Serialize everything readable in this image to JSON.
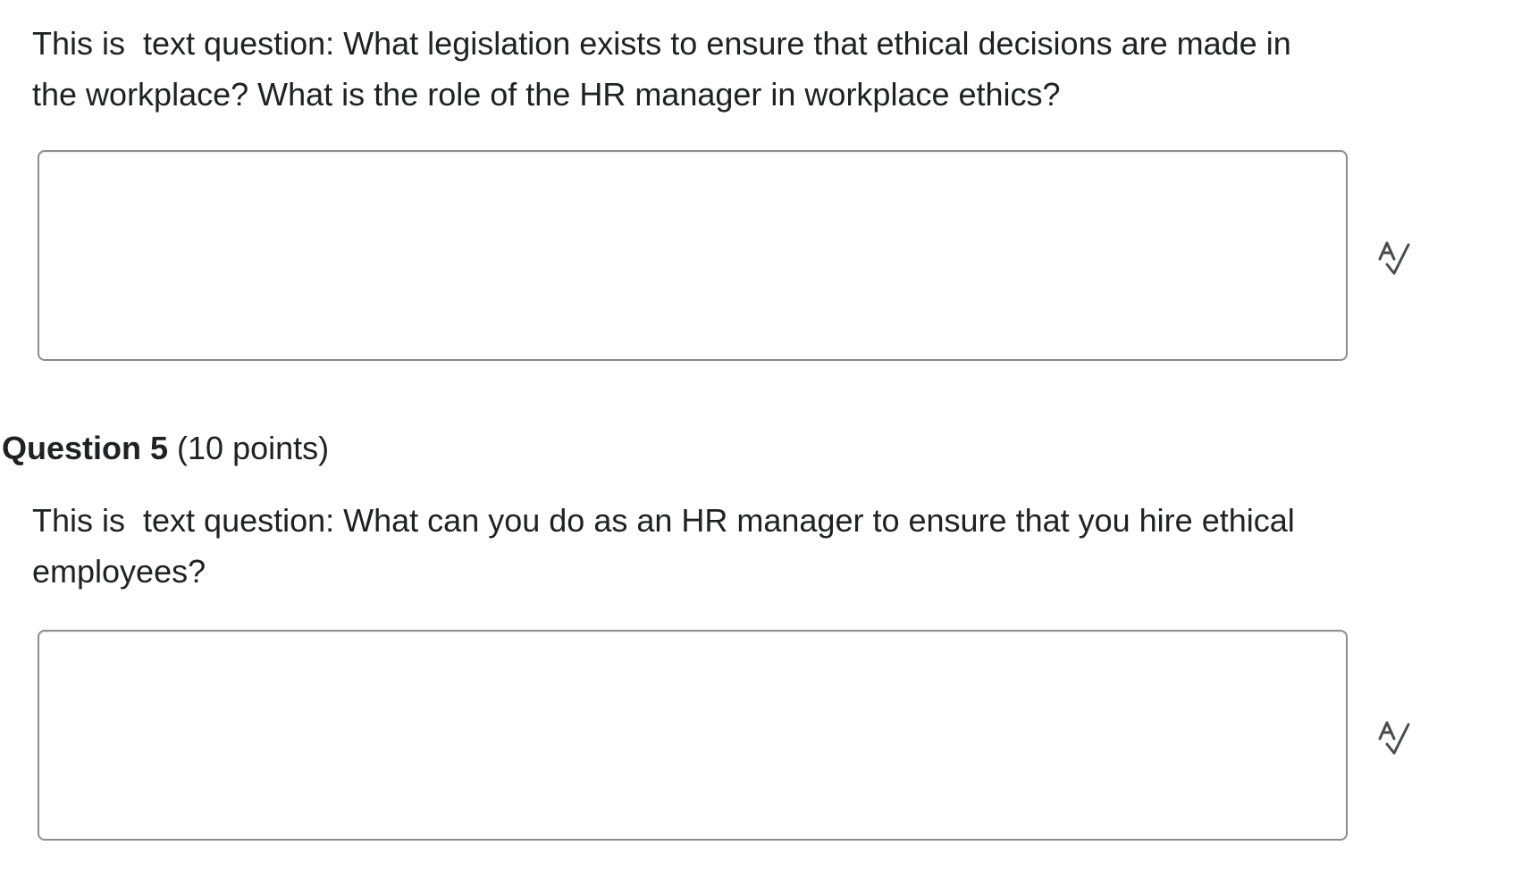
{
  "questions": [
    {
      "text": "This is  text question: What legislation exists to ensure that ethical decisions are made in the workplace? What is the role of the HR manager in workplace ethics?",
      "answer": "",
      "spellcheck_icon": "spellcheck-icon"
    },
    {
      "number_label": "Question 5",
      "points_label": " (10 points)",
      "text": "This is  text question: What can you do as an HR manager to ensure that you hire ethical employees?",
      "answer": "",
      "spellcheck_icon": "spellcheck-icon"
    }
  ],
  "colors": {
    "text": "#202122",
    "border": "#8a8c8f",
    "icon": "#494c4e"
  }
}
